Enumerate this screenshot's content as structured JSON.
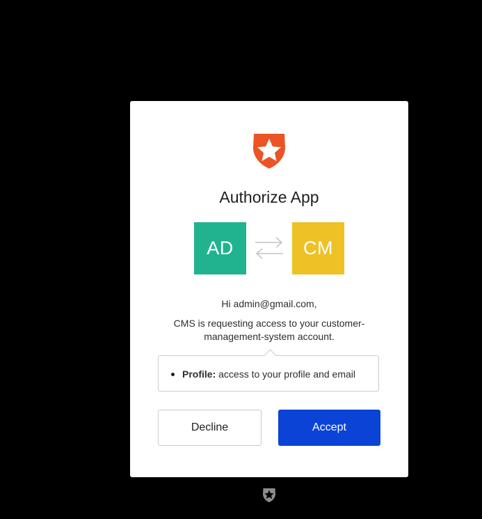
{
  "dialog": {
    "title": "Authorize App",
    "user_initials": "AD",
    "app_initials": "CM",
    "greeting": "Hi admin@gmail.com,",
    "request_text": "CMS is requesting access to your customer-management-system account.",
    "scopes": [
      {
        "name": "Profile:",
        "description": "access to your profile and email"
      }
    ],
    "decline_label": "Decline",
    "accept_label": "Accept"
  },
  "icons": {
    "brand": "shield-star-icon",
    "swap": "swap-arrows-icon",
    "footer": "shield-star-icon"
  },
  "colors": {
    "brand": "#eb5424",
    "user_avatar": "#21b38f",
    "app_avatar": "#eec125",
    "accept_button": "#0a43d6"
  }
}
